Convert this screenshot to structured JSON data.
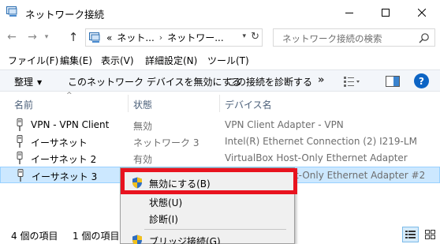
{
  "window": {
    "title": "ネットワーク接続",
    "minimize_icon": "minimize-icon",
    "maximize_icon": "maximize-icon",
    "close_icon": "close-icon"
  },
  "address": {
    "prefix": "«",
    "crumbs": [
      "ネット...",
      "ネットワー..."
    ],
    "separator": "›"
  },
  "search": {
    "placeholder": "ネットワーク接続の検索"
  },
  "menubar": {
    "items": [
      "ファイル(F)",
      "編集(E)",
      "表示(V)",
      "詳細設定(N)",
      "ツール(T)"
    ]
  },
  "commandbar": {
    "organize": "整理",
    "disable_device": "このネットワーク デバイスを無効にする",
    "diagnose": "この接続を診断する",
    "more": "»",
    "help": "?"
  },
  "columns": {
    "name": "名前",
    "status": "状態",
    "device": "デバイス名"
  },
  "connections": [
    {
      "name": "VPN - VPN Client",
      "status": "無効",
      "device": "VPN Client Adapter - VPN",
      "selected": false
    },
    {
      "name": "イーサネット",
      "status": "ネットワーク 3",
      "device": "Intel(R) Ethernet Connection (2) I219-LM",
      "selected": false
    },
    {
      "name": "イーサネット 2",
      "status": "有効",
      "device": "VirtualBox Host-Only Ethernet Adapter",
      "selected": false
    },
    {
      "name": "イーサネット 3",
      "status": "",
      "device": "VirtualBox Host-Only Ethernet Adapter #2",
      "selected": true
    }
  ],
  "statusbar": {
    "item_count": "4 個の項目",
    "selected_count": "1 個の項目を"
  },
  "context_menu": {
    "items": [
      {
        "label": "無効にする(B)",
        "shield": true,
        "highlighted": true
      },
      {
        "label": "状態(U)",
        "shield": false
      },
      {
        "label": "診断(I)",
        "shield": false
      },
      {
        "label": "ブリッジ接続(G)",
        "shield": true
      }
    ]
  },
  "colors": {
    "selection_bg": "#cce8ff",
    "highlight_border": "#e8131f",
    "command_bar_bg": "#f3f6fa",
    "help_blue": "#0c64c4"
  }
}
